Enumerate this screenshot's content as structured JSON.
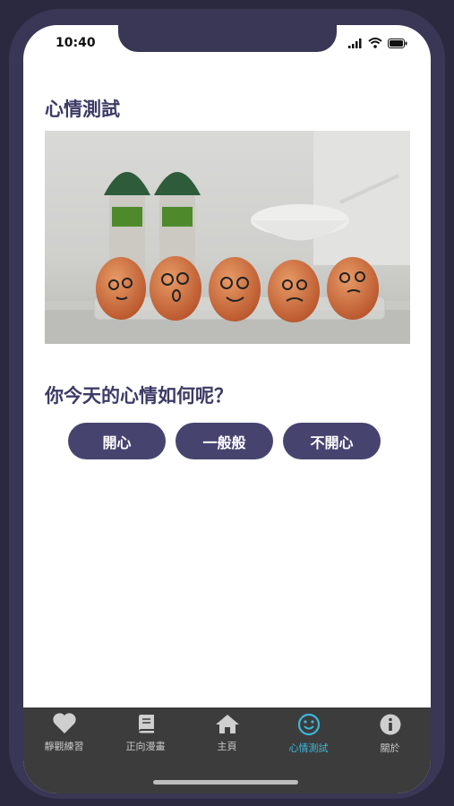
{
  "status": {
    "time": "10:40",
    "icons": [
      "signal-icon",
      "wifi-icon",
      "battery-icon"
    ]
  },
  "page": {
    "title": "心情測試",
    "question": "你今天的心情如何呢？"
  },
  "hero_image": {
    "description_icon": "eggs-photo"
  },
  "mood_options": [
    {
      "label": "開心"
    },
    {
      "label": "一般般"
    },
    {
      "label": "不開心"
    }
  ],
  "tabs": [
    {
      "label": "靜觀練習",
      "icon": "heart-icon",
      "active": false
    },
    {
      "label": "正向漫畫",
      "icon": "book-icon",
      "active": false
    },
    {
      "label": "主頁",
      "icon": "home-icon",
      "active": false
    },
    {
      "label": "心情測試",
      "icon": "smiley-icon",
      "active": true
    },
    {
      "label": "關於",
      "icon": "info-icon",
      "active": false
    }
  ],
  "colors": {
    "accent": "#46446f",
    "title": "#3d3a66",
    "tab_active": "#3bb8d8",
    "tabbar": "#3c3c3c"
  }
}
